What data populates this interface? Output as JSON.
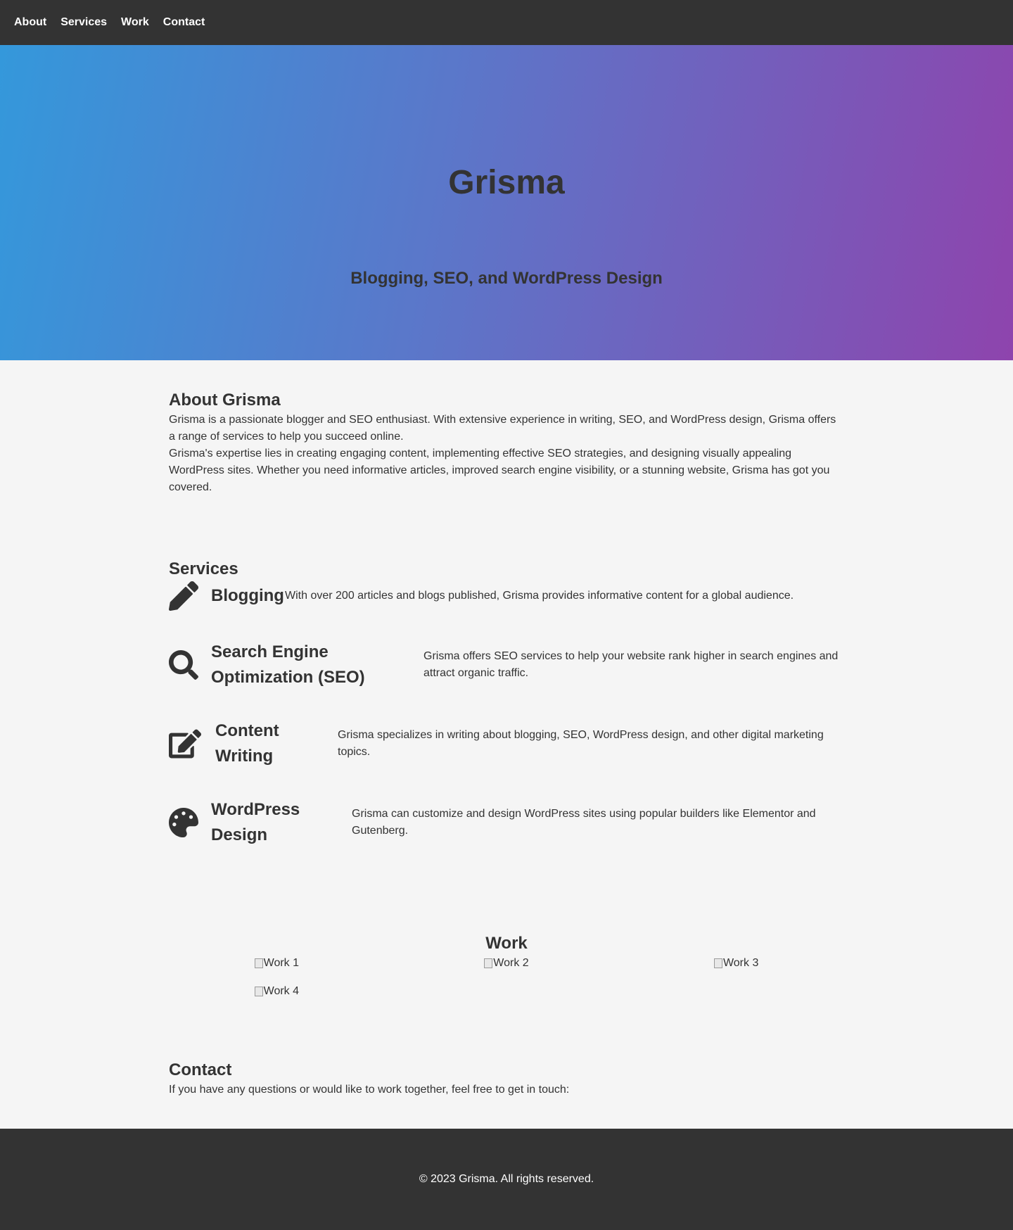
{
  "nav": {
    "items": [
      {
        "label": "About"
      },
      {
        "label": "Services"
      },
      {
        "label": "Work"
      },
      {
        "label": "Contact"
      }
    ]
  },
  "hero": {
    "title": "Grisma",
    "subtitle": "Blogging, SEO, and WordPress Design"
  },
  "about": {
    "heading": "About Grisma",
    "paragraphs": [
      "Grisma is a passionate blogger and SEO enthusiast. With extensive experience in writing, SEO, and WordPress design, Grisma offers a range of services to help you succeed online.",
      "Grisma's expertise lies in creating engaging content, implementing effective SEO strategies, and designing visually appealing WordPress sites. Whether you need informative articles, improved search engine visibility, or a stunning website, Grisma has got you covered."
    ]
  },
  "services": {
    "heading": "Services",
    "items": [
      {
        "icon": "pencil-icon",
        "title": "Blogging",
        "description": "With over 200 articles and blogs published, Grisma provides informative content for a global audience."
      },
      {
        "icon": "search-icon",
        "title": "Search Engine Optimization (SEO)",
        "description": "Grisma offers SEO services to help your website rank higher in search engines and attract organic traffic."
      },
      {
        "icon": "edit-icon",
        "title": "Content Writing",
        "description": "Grisma specializes in writing about blogging, SEO, WordPress design, and other digital marketing topics."
      },
      {
        "icon": "palette-icon",
        "title": "WordPress Design",
        "description": "Grisma can customize and design WordPress sites using popular builders like Elementor and Gutenberg."
      }
    ]
  },
  "work": {
    "heading": "Work",
    "items": [
      {
        "alt": "Work 1"
      },
      {
        "alt": "Work 2"
      },
      {
        "alt": "Work 3"
      },
      {
        "alt": "Work 4"
      }
    ]
  },
  "contact": {
    "heading": "Contact",
    "text": "If you have any questions or would like to work together, feel free to get in touch:"
  },
  "footer": {
    "text": "© 2023 Grisma. All rights reserved."
  },
  "colors": {
    "nav_bg": "#333333",
    "page_bg": "#f5f5f5",
    "text": "#333333",
    "hero_gradient_start": "#3498db",
    "hero_gradient_end": "#8e44ad"
  }
}
